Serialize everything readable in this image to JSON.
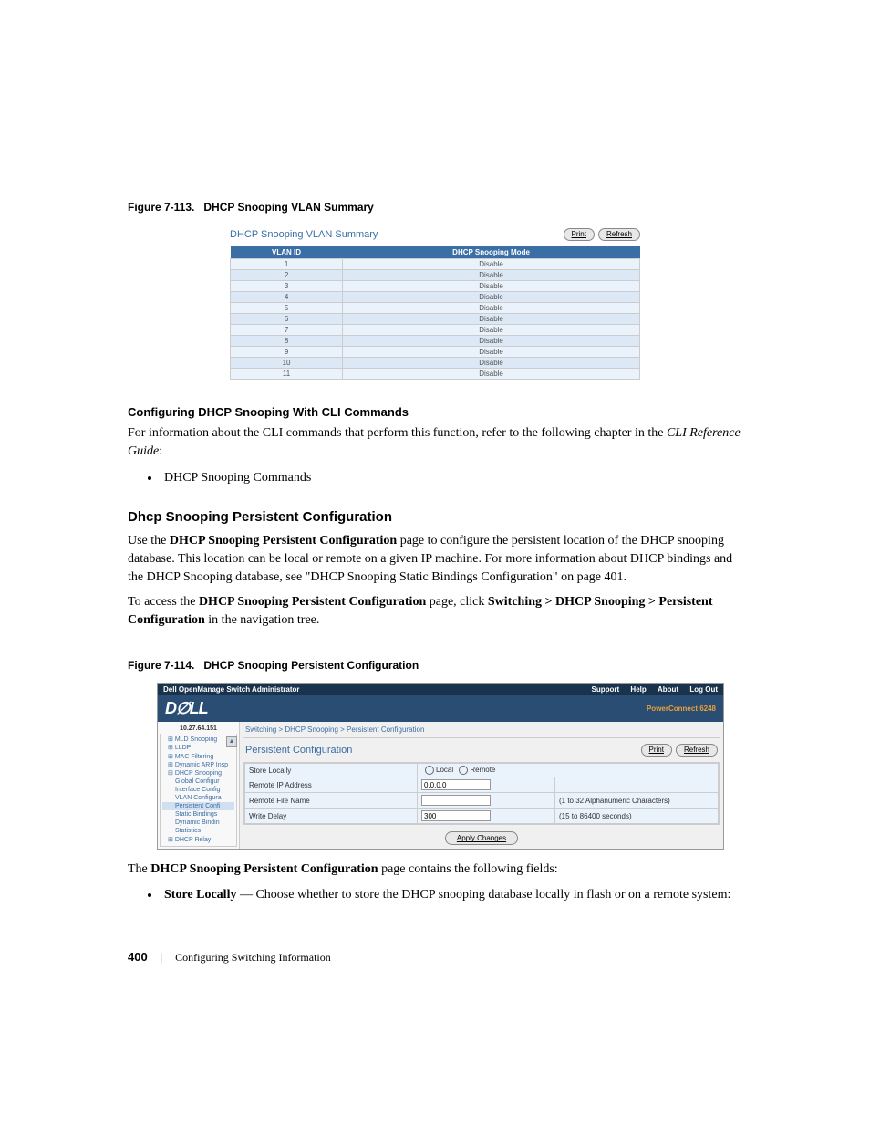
{
  "figure1": {
    "caption_prefix": "Figure 7-113.",
    "caption_title": "DHCP Snooping VLAN Summary",
    "panel_title": "DHCP Snooping VLAN Summary",
    "print_label": "Print",
    "refresh_label": "Refresh",
    "col1": "VLAN ID",
    "col2": "DHCP Snooping Mode",
    "rows": [
      {
        "id": "1",
        "mode": "Disable"
      },
      {
        "id": "2",
        "mode": "Disable"
      },
      {
        "id": "3",
        "mode": "Disable"
      },
      {
        "id": "4",
        "mode": "Disable"
      },
      {
        "id": "5",
        "mode": "Disable"
      },
      {
        "id": "6",
        "mode": "Disable"
      },
      {
        "id": "7",
        "mode": "Disable"
      },
      {
        "id": "8",
        "mode": "Disable"
      },
      {
        "id": "9",
        "mode": "Disable"
      },
      {
        "id": "10",
        "mode": "Disable"
      },
      {
        "id": "11",
        "mode": "Disable"
      }
    ]
  },
  "text": {
    "sub1": "Configuring DHCP Snooping With CLI Commands",
    "p1a": "For information about the CLI commands that perform this function, refer to the following chapter in the ",
    "p1b": "CLI Reference Guide",
    "p1c": ":",
    "bul1": "DHCP Snooping Commands",
    "h2": "Dhcp Snooping Persistent Configuration",
    "p2a": "Use the ",
    "p2b": "DHCP Snooping Persistent Configuration",
    "p2c": " page to configure the persistent location of the DHCP snooping database. This location can be local or remote on a given IP machine. For more information about DHCP bindings and the DHCP Snooping database, see \"DHCP Snooping Static Bindings Configuration\" on page 401.",
    "p3a": "To access the ",
    "p3b": "DHCP Snooping Persistent Configuration",
    "p3c": " page, click ",
    "p3d": "Switching > DHCP Snooping > Persistent Configuration",
    "p3e": " in the navigation tree.",
    "p4a": "The ",
    "p4b": "DHCP Snooping Persistent Configuration",
    "p4c": " page contains the following fields:",
    "bul2a": "Store Locally",
    "bul2b": " — Choose whether to store the DHCP snooping database locally in flash or on a remote system:"
  },
  "figure2": {
    "caption_prefix": "Figure 7-114.",
    "caption_title": "DHCP Snooping Persistent Configuration",
    "topbar_title": "Dell OpenManage Switch Administrator",
    "nav_support": "Support",
    "nav_help": "Help",
    "nav_about": "About",
    "nav_logout": "Log Out",
    "logo": "D∅LL",
    "model": "PowerConnect 6248",
    "ip": "10.27.64.151",
    "breadcrumb": "Switching > DHCP Snooping > Persistent Configuration",
    "panel_title": "Persistent Configuration",
    "print_label": "Print",
    "refresh_label": "Refresh",
    "tree": {
      "mld": "MLD Snooping",
      "lldp": "LLDP",
      "mac": "MAC Filtering",
      "arp": "Dynamic ARP Insp",
      "dhcp": "DHCP Snooping",
      "gc": "Global Configur",
      "ic": "Interface Config",
      "vc": "VLAN Configura",
      "pc": "Persistent Confi",
      "sb": "Static Bindings",
      "db": "Dynamic Bindin",
      "st": "Statistics",
      "relay": "DHCP Relay"
    },
    "form": {
      "store_label": "Store Locally",
      "store_local": "Local",
      "store_remote": "Remote",
      "ip_label": "Remote IP Address",
      "ip_value": "0.0.0.0",
      "file_label": "Remote File Name",
      "file_hint": "(1 to 32 Alphanumeric Characters)",
      "delay_label": "Write Delay",
      "delay_value": "300",
      "delay_hint": "(15 to 86400 seconds)",
      "apply": "Apply Changes"
    }
  },
  "footer": {
    "page": "400",
    "sep": "|",
    "section": "Configuring Switching Information"
  }
}
